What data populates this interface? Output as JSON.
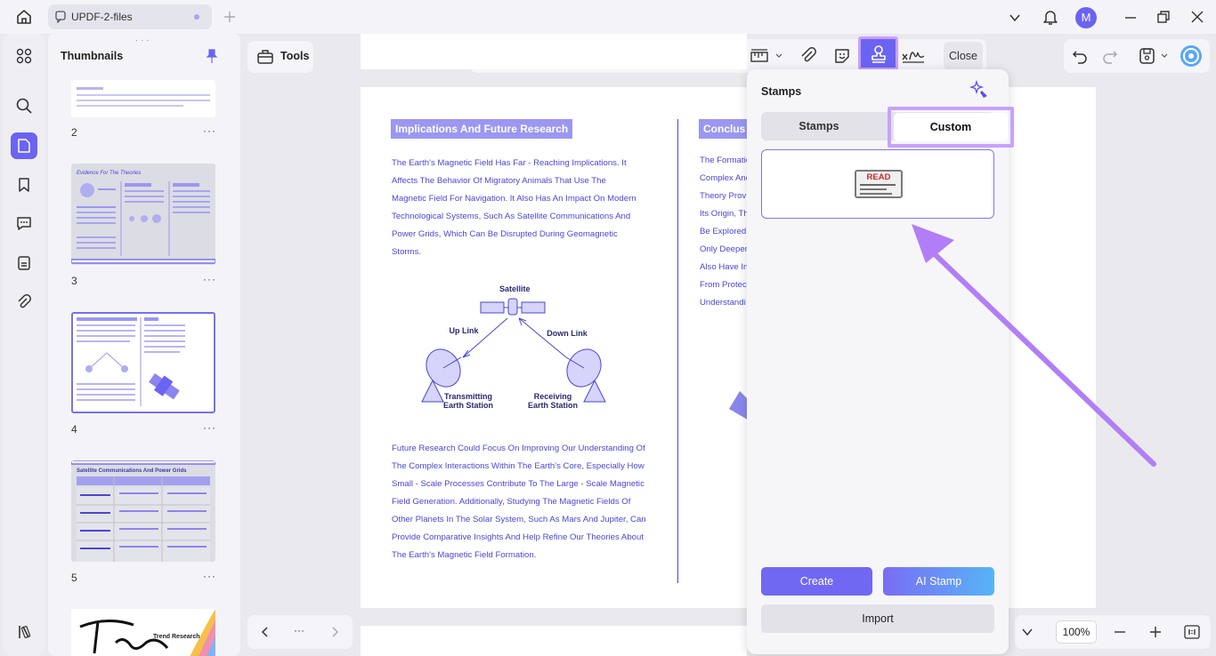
{
  "window": {
    "tab_title": "UPDF-2-files",
    "avatar_letter": "M"
  },
  "sidebar": {
    "title": "Thumbnails",
    "pages": [
      {
        "number": "2",
        "more": "···"
      },
      {
        "number": "3",
        "more": "···"
      },
      {
        "number": "4",
        "more": "···"
      },
      {
        "number": "5",
        "more": "···"
      }
    ],
    "thumb3_title": "Evidence For The Theories",
    "thumb5_title": "Satellite Communications And Power Grids",
    "thumb6_text": "Trend Research"
  },
  "toolbar": {
    "tools_label": "Tools",
    "close_label": "Close"
  },
  "document": {
    "left_heading": "Implications And Future Research",
    "left_para1": [
      "The Earth's Magnetic Field Has Far - Reaching Implications. It",
      "Affects The Behavior Of Migratory Animals That Use The",
      "Magnetic Field For Navigation. It Also Has An Impact On Modern",
      "Technological Systems, Such As Satellite Communications And",
      "Power Grids, Which Can Be Disrupted During Geomagnetic",
      "Storms."
    ],
    "diagram": {
      "satellite": "Satellite",
      "uplink": "Up Link",
      "downlink": "Down Link",
      "transmit_1": "Transmitting",
      "transmit_2": "Earth Station",
      "receive_1": "Receiving",
      "receive_2": "Earth Station"
    },
    "left_para2": [
      "Future Research Could Focus On Improving Our Understanding Of",
      "The Complex Interactions Within The Earth's Core, Especially How",
      "Small - Scale Processes Contribute To The Large - Scale Magnetic",
      "Field Generation. Additionally, Studying The Magnetic Fields Of",
      "Other Planets In The Solar System, Such As Mars And Jupiter, Can",
      "Provide Comparative Insights And Help Refine Our Theories About",
      "The Earth's Magnetic Field Formation."
    ],
    "right_heading": "Conclus",
    "right_para": [
      "The Formatio",
      "Complex And",
      "Theory Prov",
      "Its Origin, Th",
      "Be Explored",
      "Only Deeper",
      "Also Have In",
      "From Protec",
      "Understandi"
    ]
  },
  "stamps_panel": {
    "title": "Stamps",
    "tab_stamps": "Stamps",
    "tab_custom": "Custom",
    "stamp_text": "READ",
    "create_label": "Create",
    "ai_stamp_label": "AI Stamp",
    "import_label": "Import"
  },
  "footer": {
    "nav_more": "···",
    "zoom": "100%"
  },
  "colors": {
    "accent": "#6b63f2",
    "highlight": "#c9a0ff",
    "doc_text": "#4a46d6",
    "heading_bg": "#9b97f2"
  }
}
